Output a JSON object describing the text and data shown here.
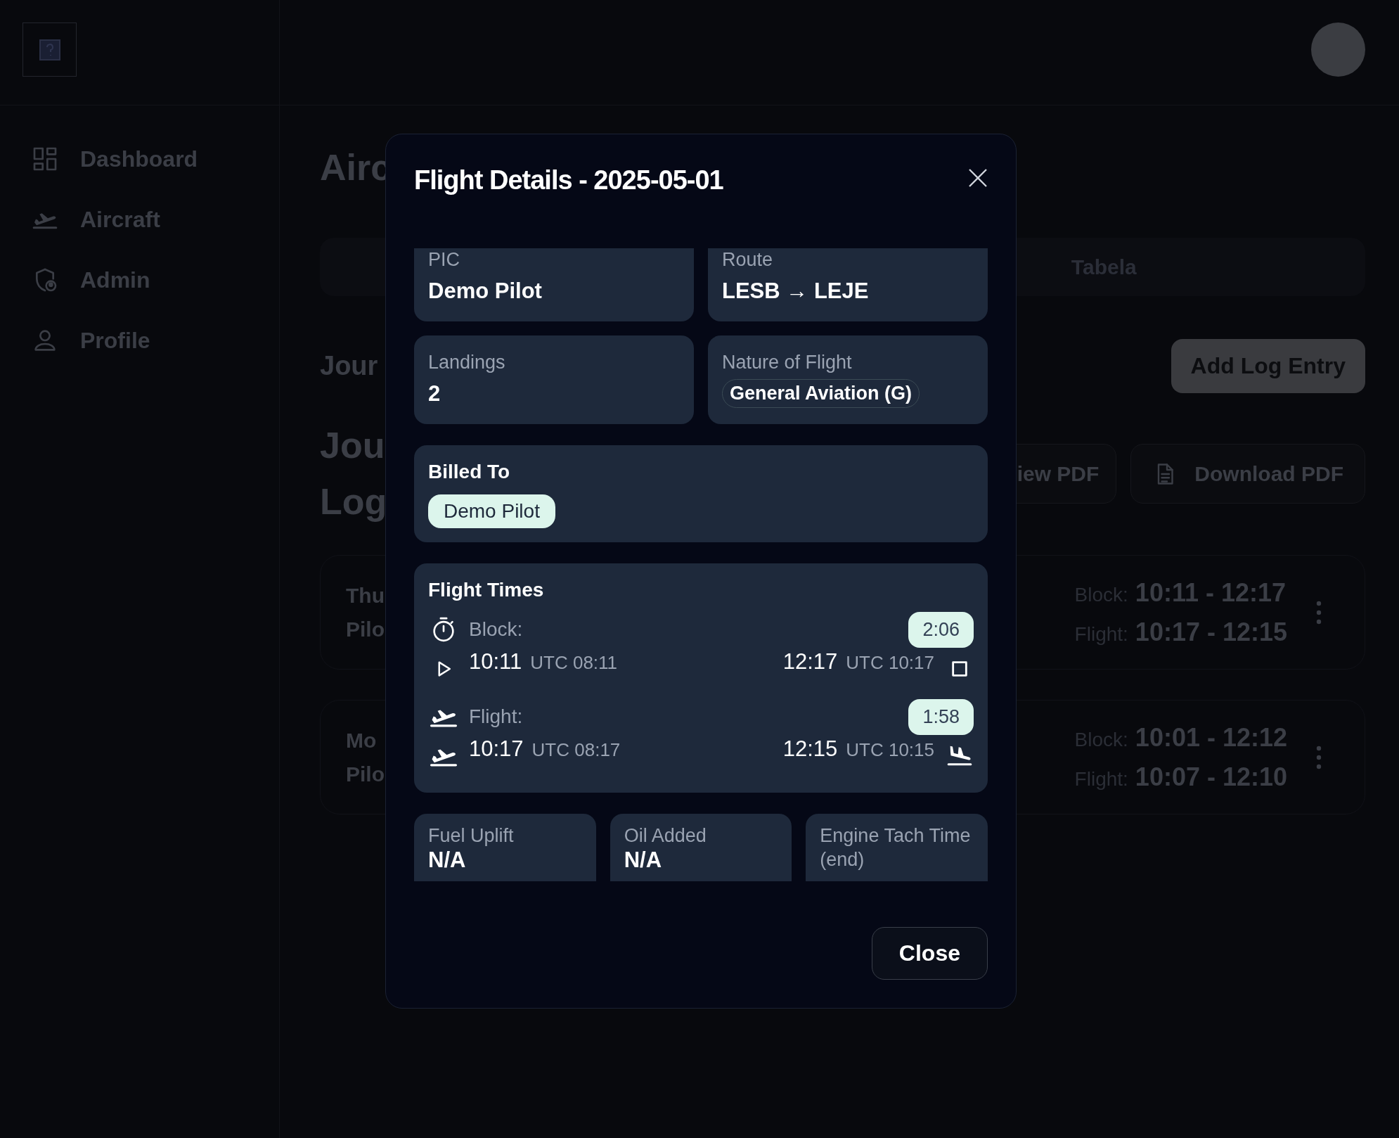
{
  "sidebar": {
    "items": [
      {
        "label": "Dashboard",
        "selected": false
      },
      {
        "label": "Aircraft",
        "selected": false
      },
      {
        "label": "Admin",
        "selected": false
      },
      {
        "label": "Profile",
        "selected": false
      }
    ]
  },
  "page": {
    "title": "Airc",
    "tab_label": "Tabela",
    "section_title": "Jour",
    "add_button": "Add Log Entry",
    "log_title_lines": [
      "Jou",
      "Log"
    ],
    "buttons": [
      {
        "label": "iew PDF",
        "kind": "view"
      },
      {
        "label": "Download PDF",
        "kind": "download"
      }
    ],
    "entries": [
      {
        "day": "Thu",
        "pilot": "Pilo",
        "block_label": "Block:",
        "block": "10:11 - 12:17",
        "flight_label": "Flight:",
        "flight": "10:17 - 12:15"
      },
      {
        "day": "Mo",
        "pilot": "Pilo",
        "block_label": "Block:",
        "block": "10:01 - 12:12",
        "flight_label": "Flight:",
        "flight": "10:07 - 12:10"
      }
    ]
  },
  "modal": {
    "title": "Flight Details - 2025-05-01",
    "fields": [
      {
        "label": "PIC",
        "value": "Demo Pilot",
        "kind": "text"
      },
      {
        "label": "Route",
        "value": "LESB → LEJE",
        "kind": "text"
      },
      {
        "label": "Landings",
        "value": "2",
        "kind": "text"
      },
      {
        "label": "Nature of Flight",
        "value": "General Aviation (G)",
        "kind": "tag"
      }
    ],
    "billed_to": {
      "title": "Billed To",
      "chips": [
        "Demo Pilot"
      ]
    },
    "flight_times": {
      "title": "Flight Times",
      "rows": [
        {
          "kind": "block",
          "label": "Block:",
          "duration": "2:06",
          "start": "10:11",
          "start_utc": "UTC 08:11",
          "end": "12:17",
          "end_utc": "UTC 10:17"
        },
        {
          "kind": "flight",
          "label": "Flight:",
          "duration": "1:58",
          "start": "10:17",
          "start_utc": "UTC 08:17",
          "end": "12:15",
          "end_utc": "UTC 10:15"
        }
      ]
    },
    "extras": [
      {
        "label": "Fuel Uplift",
        "value": "N/A"
      },
      {
        "label": "Oil Added",
        "value": "N/A"
      },
      {
        "label": "Engine Tach Time (end)"
      }
    ],
    "close_button": "Close"
  }
}
